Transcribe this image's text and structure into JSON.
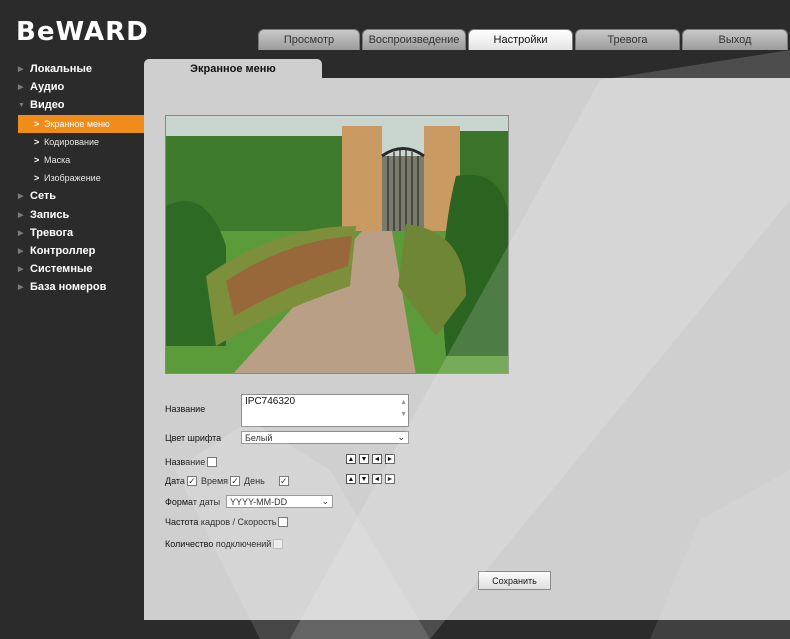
{
  "brand": {
    "logo": "BeWARD"
  },
  "topnav": [
    {
      "label": "Просмотр",
      "active": false
    },
    {
      "label": "Воспроизведение",
      "active": false
    },
    {
      "label": "Настройки",
      "active": true
    },
    {
      "label": "Тревога",
      "active": false
    },
    {
      "label": "Выход",
      "active": false
    }
  ],
  "sidebar": {
    "items": [
      {
        "label": "Локальные"
      },
      {
        "label": "Аудио"
      },
      {
        "label": "Видео",
        "expanded": true,
        "children": [
          {
            "label": "Экранное меню",
            "active": true
          },
          {
            "label": "Кодирование"
          },
          {
            "label": "Маска"
          },
          {
            "label": "Изображение"
          }
        ]
      },
      {
        "label": "Сеть"
      },
      {
        "label": "Запись"
      },
      {
        "label": "Тревога"
      },
      {
        "label": "Контроллер"
      },
      {
        "label": "Системные"
      },
      {
        "label": "База номеров"
      }
    ]
  },
  "content_tab": "Экранное меню",
  "form": {
    "name_label": "Название",
    "name_value": "IPC746320",
    "font_color_label": "Цвет шрифта",
    "font_color_value": "Белый",
    "show_name_label": "Название",
    "show_name_checked": false,
    "date_label": "Дата",
    "date_checked": true,
    "time_label": "Время",
    "time_checked": true,
    "day_label": "День",
    "day_checked": true,
    "date_format_label": "Формат даты",
    "date_format_value": "YYYY-MM-DD",
    "fps_label": "Частота кадров / Скорость",
    "fps_checked": false,
    "connections_label": "Количество подключений",
    "connections_checked": false,
    "save_label": "Сохранить"
  },
  "icons": {
    "arrow_up": "▲",
    "arrow_down": "▼",
    "arrow_left": "◄",
    "arrow_right": "►",
    "check": "✓"
  },
  "colors": {
    "accent": "#f08c1a",
    "panel": "#cfcfcf",
    "background": "#2b2b2b"
  }
}
